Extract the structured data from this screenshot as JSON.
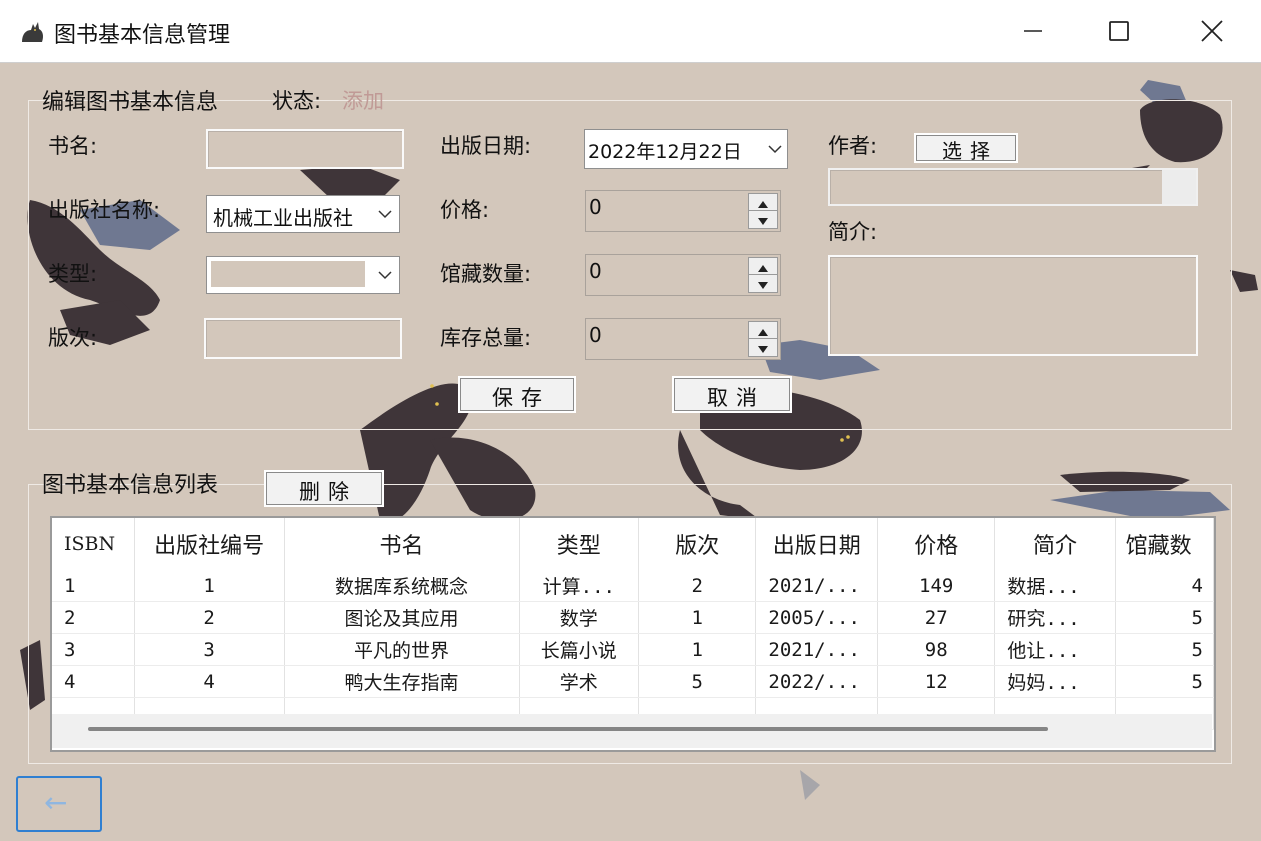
{
  "window": {
    "title": "图书基本信息管理",
    "icons": {
      "app": "cat-icon",
      "min": "minimize-icon",
      "max": "maximize-icon",
      "close": "close-icon"
    }
  },
  "edit": {
    "group_title": "编辑图书基本信息",
    "state_label": "状态:",
    "state_value": "添加",
    "book_name_label": "书名:",
    "book_name_value": "",
    "publisher_label": "出版社名称:",
    "publisher_value": "机械工业出版社",
    "type_label": "类型:",
    "type_value": "",
    "edition_label": "版次:",
    "edition_value": "",
    "date_label": "出版日期:",
    "date_value": "2022年12月22日",
    "price_label": "价格:",
    "price_value": "0",
    "holdings_label": "馆藏数量:",
    "holdings_value": "0",
    "stock_label": "库存总量:",
    "stock_value": "0",
    "author_label": "作者:",
    "author_button": "选择",
    "author_value": "",
    "intro_label": "简介:",
    "intro_value": "",
    "save_button": "保存",
    "cancel_button": "取消"
  },
  "list": {
    "group_title": "图书基本信息列表",
    "delete_button": "删除",
    "columns": [
      "ISBN",
      "出版社编号",
      "书名",
      "类型",
      "版次",
      "出版日期",
      "价格",
      "简介",
      "馆藏数"
    ],
    "rows": [
      [
        "1",
        "1",
        "数据库系统概念",
        "计算...",
        "2",
        "2021/...",
        "149",
        "数据...",
        "4"
      ],
      [
        "2",
        "2",
        "图论及其应用",
        "数学",
        "1",
        "2005/...",
        "27",
        "研究...",
        "5"
      ],
      [
        "3",
        "3",
        "平凡的世界",
        "长篇小说",
        "1",
        "2021/...",
        "98",
        "他让...",
        "5"
      ],
      [
        "4",
        "4",
        "鸭大生存指南",
        "学术",
        "5",
        "2022/...",
        "12",
        "妈妈...",
        "5"
      ],
      [
        "",
        "",
        "",
        "",
        "",
        "",
        "",
        "",
        ""
      ]
    ]
  },
  "back_button": {
    "label": "←",
    "icon": "back-arrow-icon"
  },
  "colors": {
    "background": "#d3c7bb",
    "cat_dark": "#3f3539",
    "cat_blue": "#6f7891",
    "accent": "#2f7fd1",
    "state": "#c09a96"
  }
}
